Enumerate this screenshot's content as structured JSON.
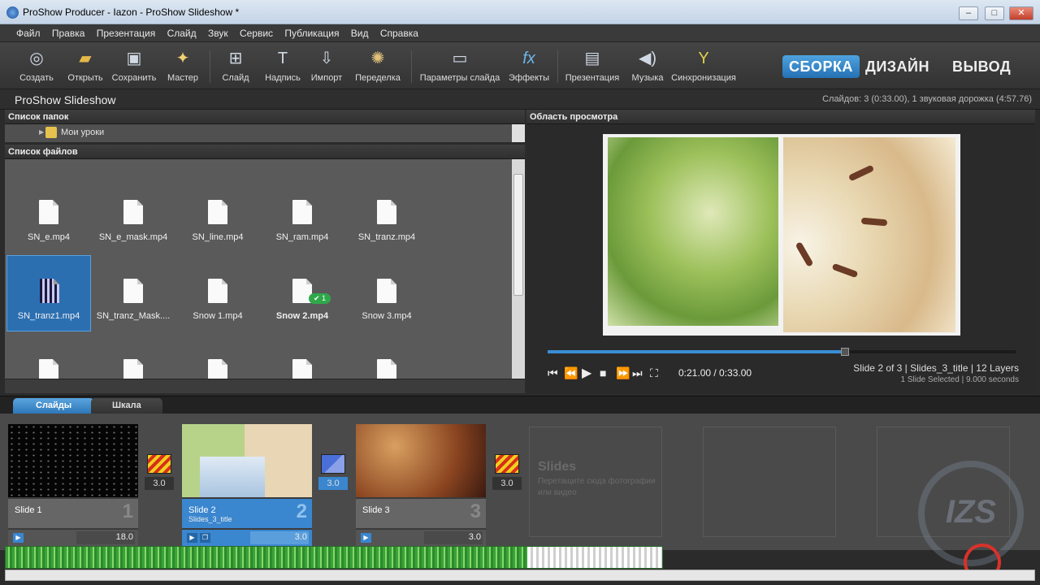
{
  "window": {
    "title": "ProShow Producer - Iazon - ProShow Slideshow *"
  },
  "menu": [
    "Файл",
    "Правка",
    "Презентация",
    "Слайд",
    "Звук",
    "Сервис",
    "Публикация",
    "Вид",
    "Справка"
  ],
  "toolbar": {
    "create": "Создать",
    "open": "Открыть",
    "save": "Сохранить",
    "wizard": "Мастер",
    "slide": "Слайд",
    "caption": "Надпись",
    "import": "Импорт",
    "remake": "Переделка",
    "slide_options": "Параметры слайда",
    "effects": "Эффекты",
    "show": "Презентация",
    "music": "Музыка",
    "sync": "Синхронизация"
  },
  "modes": {
    "build": "СБОРКА",
    "design": "ДИЗАЙН",
    "output": "ВЫВОД"
  },
  "project": {
    "name": "ProShow Slideshow",
    "info": "Слайдов: 3 (0:33.00), 1 звуковая дорожка (4:57.76)"
  },
  "folders": {
    "header": "Список папок",
    "item": "Мои уроки"
  },
  "files": {
    "header": "Список файлов",
    "row1": [
      "SN_e.mp4",
      "SN_e_mask.mp4",
      "SN_line.mp4",
      "SN_ram.mp4",
      "SN_tranz.mp4"
    ],
    "row2": [
      "SN_tranz1.mp4",
      "SN_tranz_Mask....",
      "Snow 1.mp4",
      "Snow 2.mp4",
      "Snow 3.mp4"
    ],
    "snow2_badge": "1"
  },
  "preview": {
    "header": "Область просмотра",
    "timecode": "0:21.00 / 0:33.00",
    "progress": 0.636,
    "info_line1": "Slide 2 of 3  |  Slides_3_title  |  12 Layers",
    "info_line2": "1 Slide Selected  |  9.000 seconds"
  },
  "tabs": {
    "slides": "Слайды",
    "timeline": "Шкала"
  },
  "slides": [
    {
      "name": "Slide 1",
      "subtitle": "",
      "num": "1",
      "dur": "18.0"
    },
    {
      "name": "Slide 2",
      "subtitle": "Slides_3_title",
      "num": "2",
      "dur": "3.0"
    },
    {
      "name": "Slide 3",
      "subtitle": "",
      "num": "3",
      "dur": "3.0"
    }
  ],
  "transitions": [
    "3.0",
    "3.0",
    "3.0"
  ],
  "empty_slot": {
    "title": "Slides",
    "hint": "Перетащите сюда фотографии или видео"
  },
  "watermark": "IZS"
}
